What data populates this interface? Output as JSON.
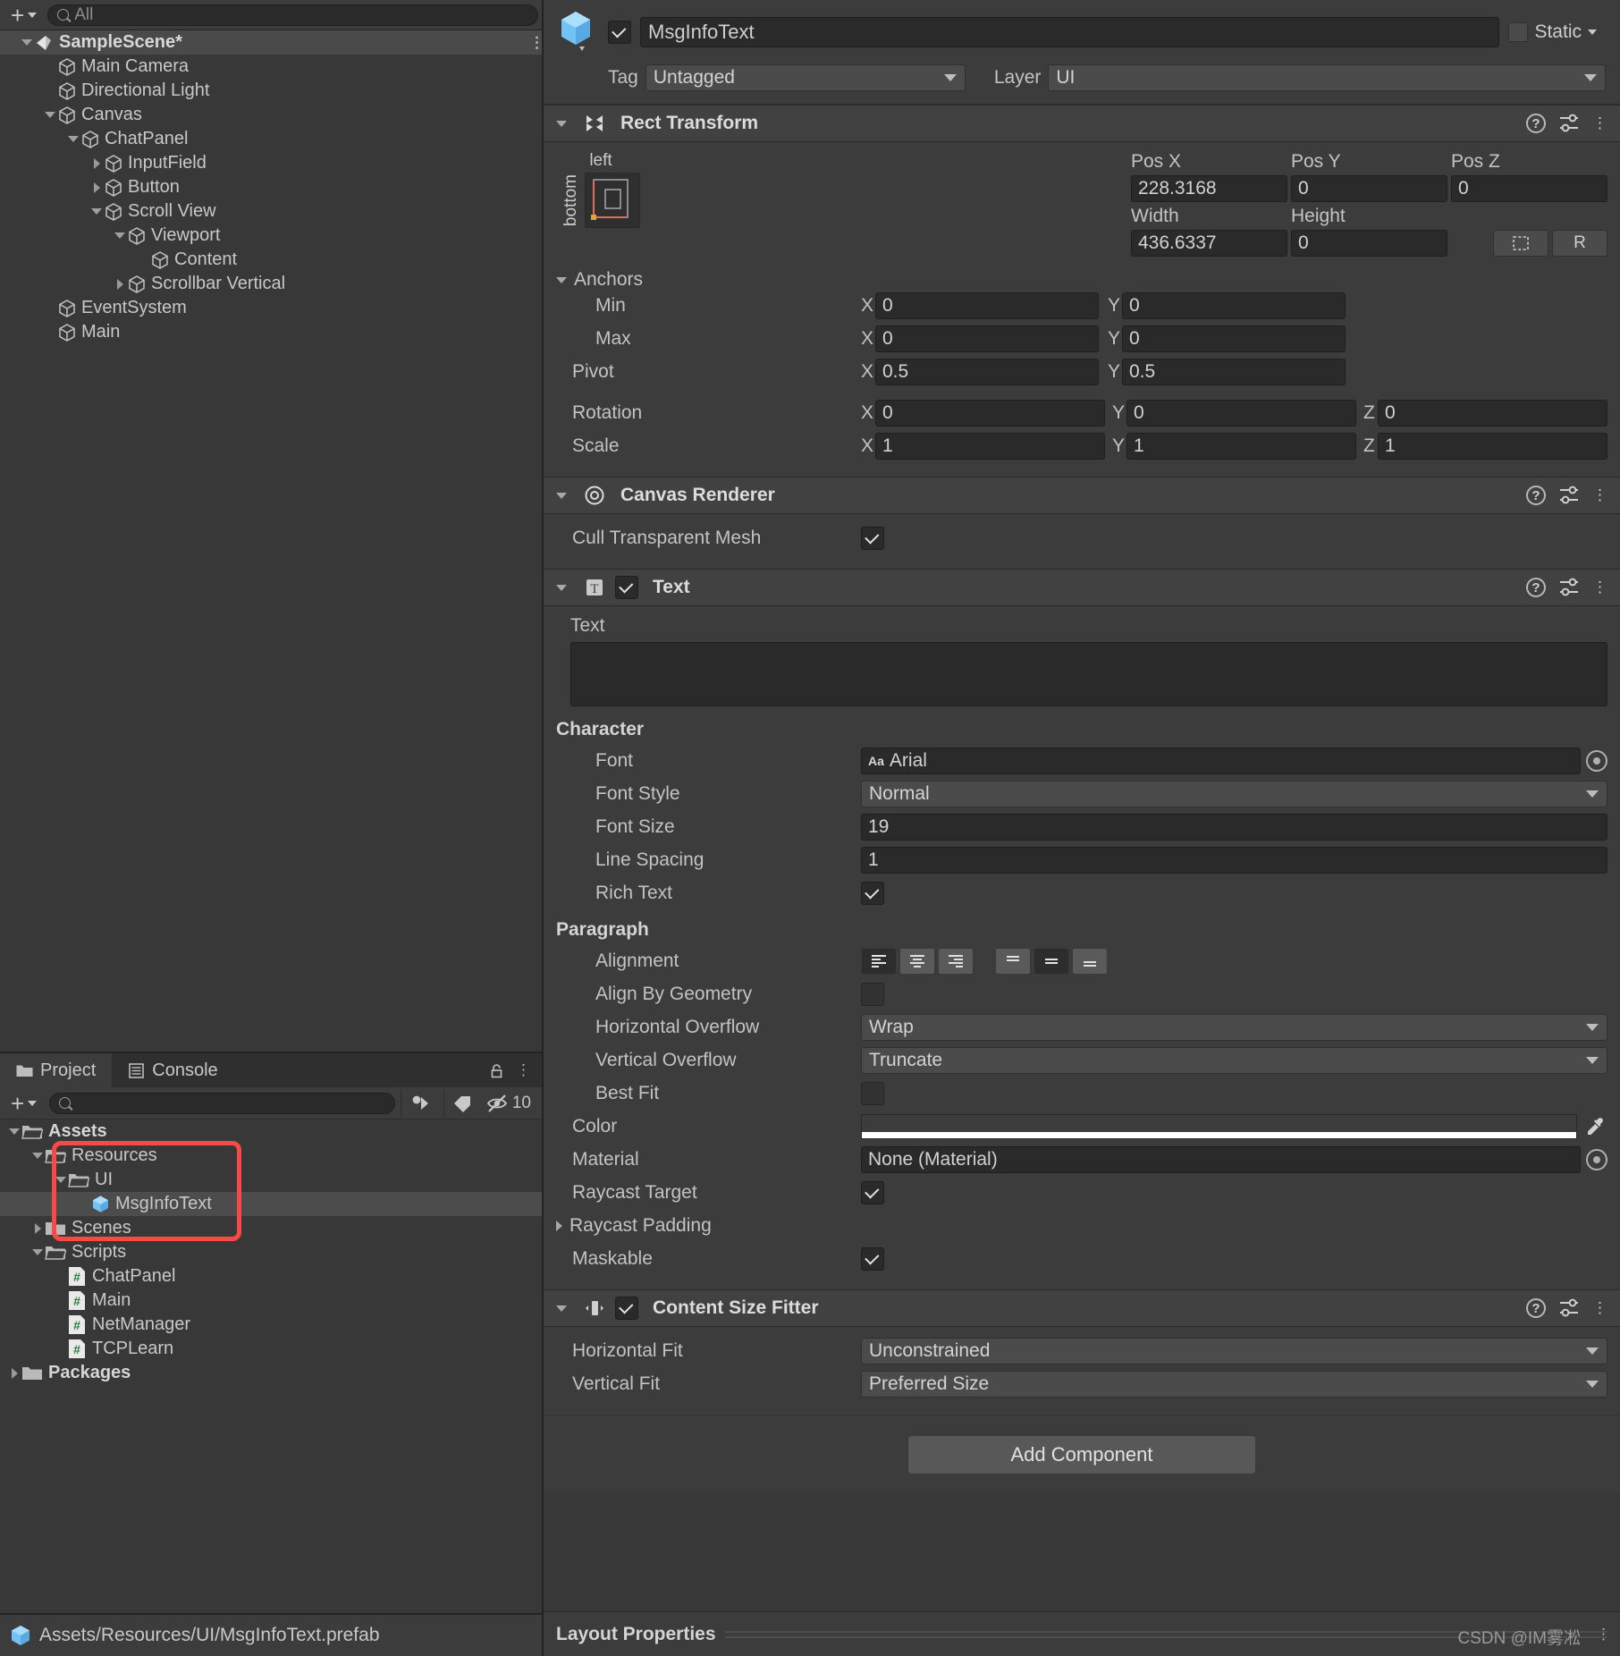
{
  "hierarchy": {
    "add_label": "+",
    "search_placeholder": "All",
    "rows": [
      {
        "label": "SampleScene*",
        "indent": 0,
        "icon": "scene-icon",
        "expanded": true,
        "selected": true,
        "bold": true
      },
      {
        "label": "Main Camera",
        "indent": 1,
        "icon": "gameobject-icon",
        "expanded": null
      },
      {
        "label": "Directional Light",
        "indent": 1,
        "icon": "gameobject-icon",
        "expanded": null
      },
      {
        "label": "Canvas",
        "indent": 1,
        "icon": "gameobject-icon",
        "expanded": true
      },
      {
        "label": "ChatPanel",
        "indent": 2,
        "icon": "gameobject-icon",
        "expanded": true
      },
      {
        "label": "InputField",
        "indent": 3,
        "icon": "gameobject-icon",
        "expanded": false
      },
      {
        "label": "Button",
        "indent": 3,
        "icon": "gameobject-icon",
        "expanded": false
      },
      {
        "label": "Scroll View",
        "indent": 3,
        "icon": "gameobject-icon",
        "expanded": true
      },
      {
        "label": "Viewport",
        "indent": 4,
        "icon": "gameobject-icon",
        "expanded": true
      },
      {
        "label": "Content",
        "indent": 5,
        "icon": "gameobject-icon",
        "expanded": null
      },
      {
        "label": "Scrollbar Vertical",
        "indent": 4,
        "icon": "gameobject-icon",
        "expanded": false
      },
      {
        "label": "EventSystem",
        "indent": 1,
        "icon": "gameobject-icon",
        "expanded": null
      },
      {
        "label": "Main",
        "indent": 1,
        "icon": "gameobject-icon",
        "expanded": null
      }
    ]
  },
  "project": {
    "tabs": [
      {
        "label": "Project",
        "icon": "folder-icon",
        "active": true
      },
      {
        "label": "Console",
        "icon": "console-icon",
        "active": false
      }
    ],
    "search_placeholder": "",
    "hidden_count": "10",
    "rows": [
      {
        "label": "Assets",
        "indent": 0,
        "icon": "folder-open-icon",
        "expanded": true,
        "bold": true
      },
      {
        "label": "Resources",
        "indent": 1,
        "icon": "folder-open-icon",
        "expanded": true
      },
      {
        "label": "UI",
        "indent": 2,
        "icon": "folder-open-icon",
        "expanded": true
      },
      {
        "label": "MsgInfoText",
        "indent": 3,
        "icon": "prefab-icon",
        "selected": true
      },
      {
        "label": "Scenes",
        "indent": 1,
        "icon": "folder-icon",
        "expanded": false
      },
      {
        "label": "Scripts",
        "indent": 1,
        "icon": "folder-open-icon",
        "expanded": true
      },
      {
        "label": "ChatPanel",
        "indent": 2,
        "icon": "csharp-script-icon"
      },
      {
        "label": "Main",
        "indent": 2,
        "icon": "csharp-script-icon"
      },
      {
        "label": "NetManager",
        "indent": 2,
        "icon": "csharp-script-icon"
      },
      {
        "label": "TCPLearn",
        "indent": 2,
        "icon": "csharp-script-icon"
      },
      {
        "label": "Packages",
        "indent": 0,
        "icon": "folder-icon",
        "expanded": false,
        "bold": true
      }
    ],
    "highlight_color": "#f74a46"
  },
  "statusbar": {
    "path": "Assets/Resources/UI/MsgInfoText.prefab",
    "icon": "prefab-icon"
  },
  "inspector": {
    "object_name": "MsgInfoText",
    "enabled": true,
    "static_label": "Static",
    "tag_label": "Tag",
    "tag_value": "Untagged",
    "layer_label": "Layer",
    "layer_value": "UI",
    "rect_transform": {
      "title": "Rect Transform",
      "anchor_preset_top": "left",
      "anchor_preset_side": "bottom",
      "pos_x_label": "Pos X",
      "pos_x": "228.3168",
      "pos_y_label": "Pos Y",
      "pos_y": "0",
      "pos_z_label": "Pos Z",
      "pos_z": "0",
      "width_label": "Width",
      "width": "436.6337",
      "height_label": "Height",
      "height": "0",
      "blueprint_label": "",
      "raw_label": "R",
      "anchors_label": "Anchors",
      "min_label": "Min",
      "min_x": "0",
      "min_y": "0",
      "max_label": "Max",
      "max_x": "0",
      "max_y": "0",
      "pivot_label": "Pivot",
      "pivot_x": "0.5",
      "pivot_y": "0.5",
      "rotation_label": "Rotation",
      "rot_x": "0",
      "rot_y": "0",
      "rot_z": "0",
      "scale_label": "Scale",
      "scale_x": "1",
      "scale_y": "1",
      "scale_z": "1"
    },
    "canvas_renderer": {
      "title": "Canvas Renderer",
      "cull_label": "Cull Transparent Mesh",
      "cull_checked": true
    },
    "text_component": {
      "title": "Text",
      "enabled": true,
      "text_label": "Text",
      "text_value": "",
      "character_label": "Character",
      "font_label": "Font",
      "font_value": "Arial",
      "font_style_label": "Font Style",
      "font_style_value": "Normal",
      "font_size_label": "Font Size",
      "font_size_value": "19",
      "line_spacing_label": "Line Spacing",
      "line_spacing_value": "1",
      "rich_text_label": "Rich Text",
      "rich_text_checked": true,
      "paragraph_label": "Paragraph",
      "alignment_label": "Alignment",
      "align_h_selected": 0,
      "align_v_selected": 1,
      "align_by_geometry_label": "Align By Geometry",
      "align_by_geometry_checked": false,
      "horizontal_overflow_label": "Horizontal Overflow",
      "horizontal_overflow_value": "Wrap",
      "vertical_overflow_label": "Vertical Overflow",
      "vertical_overflow_value": "Truncate",
      "best_fit_label": "Best Fit",
      "best_fit_checked": false,
      "color_label": "Color",
      "color_value": "#FFFFFF",
      "material_label": "Material",
      "material_value": "None (Material)",
      "raycast_target_label": "Raycast Target",
      "raycast_target_checked": true,
      "raycast_padding_label": "Raycast Padding",
      "maskable_label": "Maskable",
      "maskable_checked": true
    },
    "content_size_fitter": {
      "title": "Content Size Fitter",
      "enabled": true,
      "horizontal_fit_label": "Horizontal Fit",
      "horizontal_fit_value": "Unconstrained",
      "vertical_fit_label": "Vertical Fit",
      "vertical_fit_value": "Preferred Size"
    },
    "add_component_label": "Add Component",
    "layout_properties_label": "Layout Properties"
  },
  "watermark": "CSDN @IM雾凇"
}
